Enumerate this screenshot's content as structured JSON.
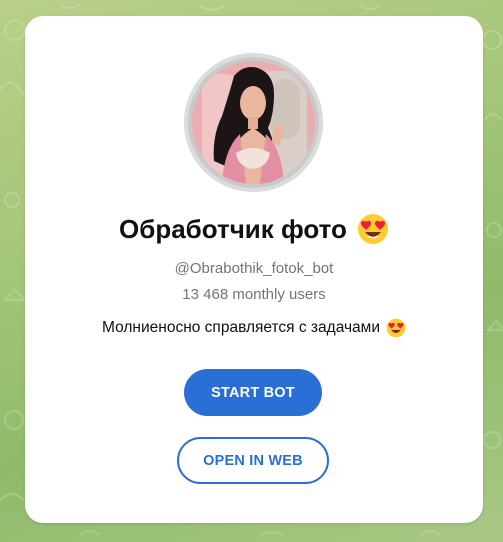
{
  "bot": {
    "name": "Обработчик фото",
    "name_emoji": "heart-eyes-emoji",
    "username": "@Obrabothik_fotok_bot",
    "monthly_users": "13 468 monthly users",
    "description": "Молниеносно справляется с задачами",
    "description_emoji": "heart-eyes-emoji"
  },
  "actions": {
    "start_label": "START BOT",
    "web_label": "OPEN IN WEB"
  },
  "colors": {
    "accent": "#2a6fd6",
    "background": "#a6c77a",
    "card": "#ffffff",
    "muted_text": "#707579"
  }
}
